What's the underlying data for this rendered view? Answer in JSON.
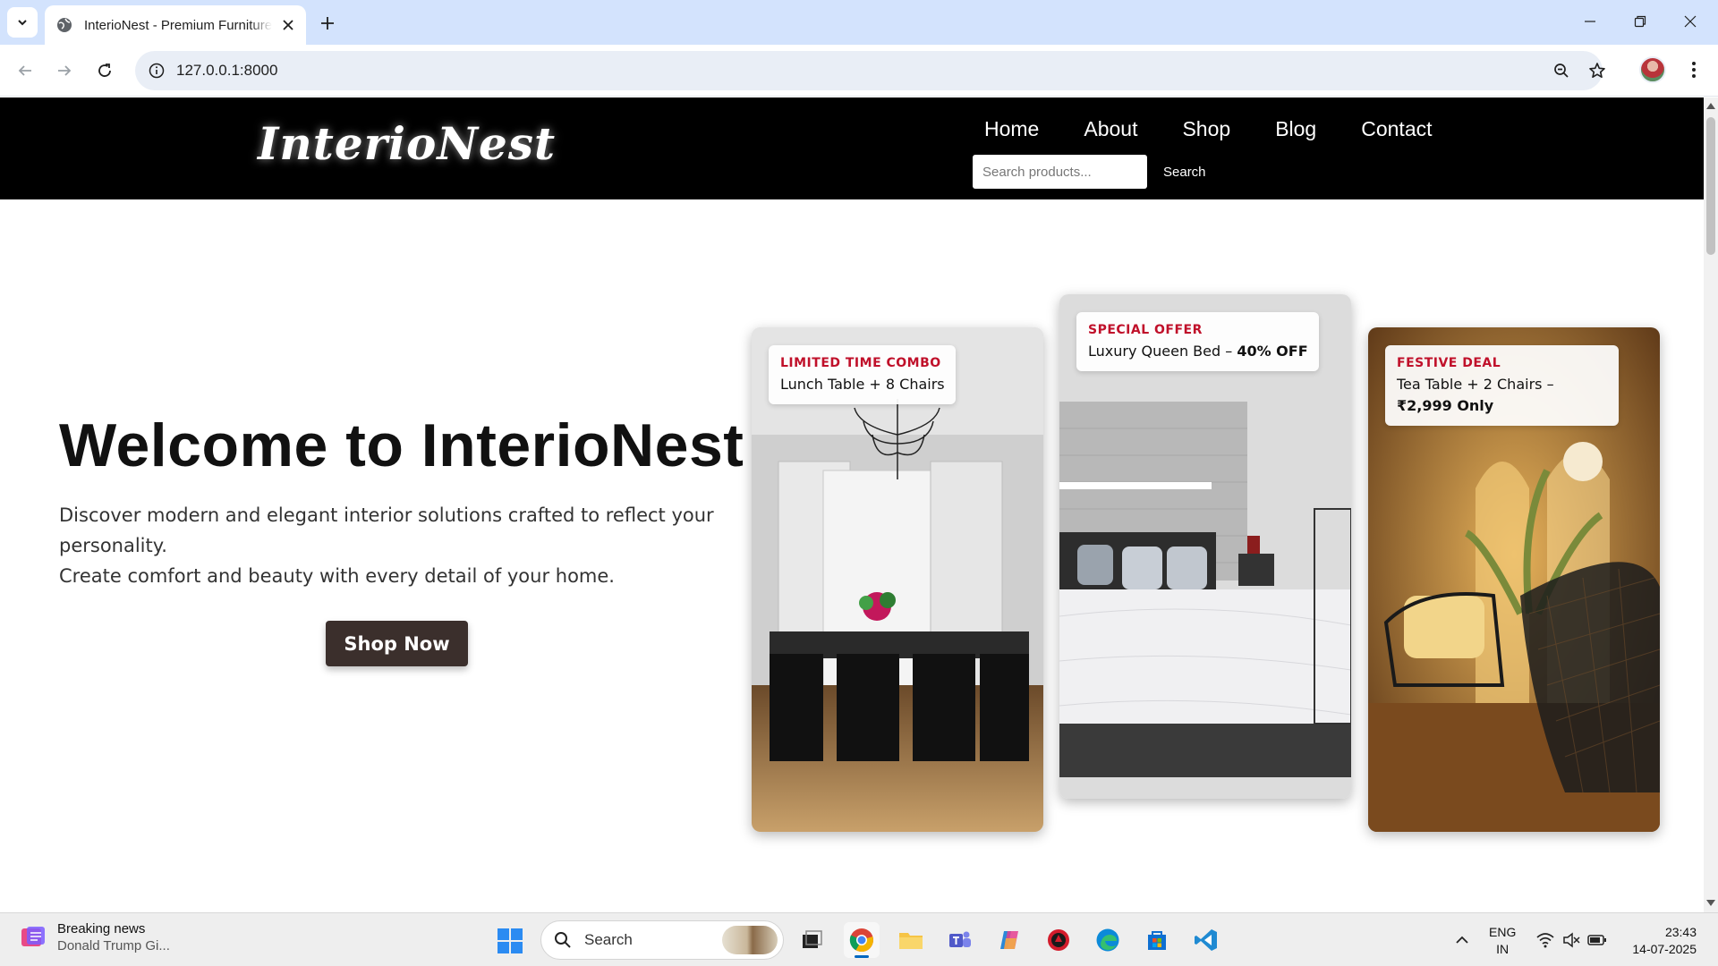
{
  "browser": {
    "tab_title": "InterioNest - Premium Furniture",
    "url": "127.0.0.1:8000"
  },
  "site": {
    "logo": "InterioNest",
    "nav": [
      "Home",
      "About",
      "Shop",
      "Blog",
      "Contact"
    ],
    "search_placeholder": "Search products...",
    "search_button": "Search"
  },
  "hero": {
    "title": "Welcome to InterioNest",
    "line1": "Discover modern and elegant interior solutions crafted to reflect your personality.",
    "line2": "Create comfort and beauty with every detail of your home.",
    "cta": "Shop Now"
  },
  "cards": [
    {
      "tag": "LIMITED TIME COMBO",
      "title": "Lunch Table + 8 Chairs",
      "highlight": ""
    },
    {
      "tag": "SPECIAL OFFER",
      "title": "Luxury Queen Bed – ",
      "highlight": "40% OFF"
    },
    {
      "tag": "FESTIVE DEAL",
      "title": "Tea Table + 2 Chairs – ",
      "highlight": "₹2,999 Only"
    }
  ],
  "taskbar": {
    "news_title": "Breaking news",
    "news_sub": "Donald Trump Gi...",
    "search_label": "Search",
    "lang_1": "ENG",
    "lang_2": "IN",
    "time": "23:43",
    "date": "14-07-2025"
  },
  "colors": {
    "header_bg": "#000000",
    "cta_bg": "#3b2f2c",
    "badge_tag": "#c0102a",
    "tabbar_bg": "#d3e3fd"
  }
}
